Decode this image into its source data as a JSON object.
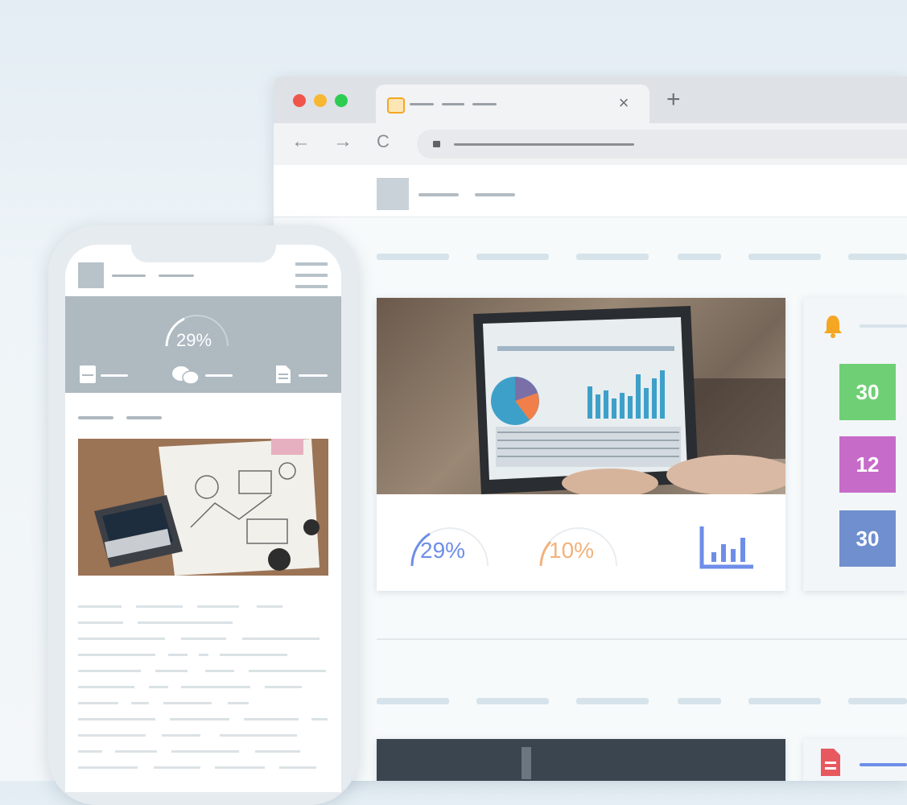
{
  "colors": {
    "traffic_red": "#f0554b",
    "traffic_yellow": "#f7b731",
    "traffic_green": "#2ecc52",
    "gauge_blue": "#6d8ee8",
    "gauge_orange": "#f2b27c",
    "tile_green": "#6fcf74",
    "tile_magenta": "#c76bc9",
    "tile_blue": "#6f8fcf",
    "phone_header": "#aeb9c0",
    "placeholder_bar": "#d6e3ea",
    "bell": "#f5a623",
    "doc_red": "#e8585f"
  },
  "browser": {
    "tab_close": "×",
    "new_tab": "+",
    "back": "←",
    "forward": "→",
    "reload": "C"
  },
  "dashboard": {
    "gauge_primary": "29%",
    "gauge_secondary": "10%",
    "gauge_primary_value": 29,
    "gauge_secondary_value": 10,
    "tiles": [
      "30",
      "12",
      "30"
    ]
  },
  "phone": {
    "gauge": "29%",
    "gauge_value": 29
  },
  "icons": [
    "favicon-icon",
    "lock-icon",
    "bar-chart-icon",
    "bell-icon",
    "document-icon",
    "hamburger-menu-icon",
    "chat-icon",
    "form-icon"
  ]
}
